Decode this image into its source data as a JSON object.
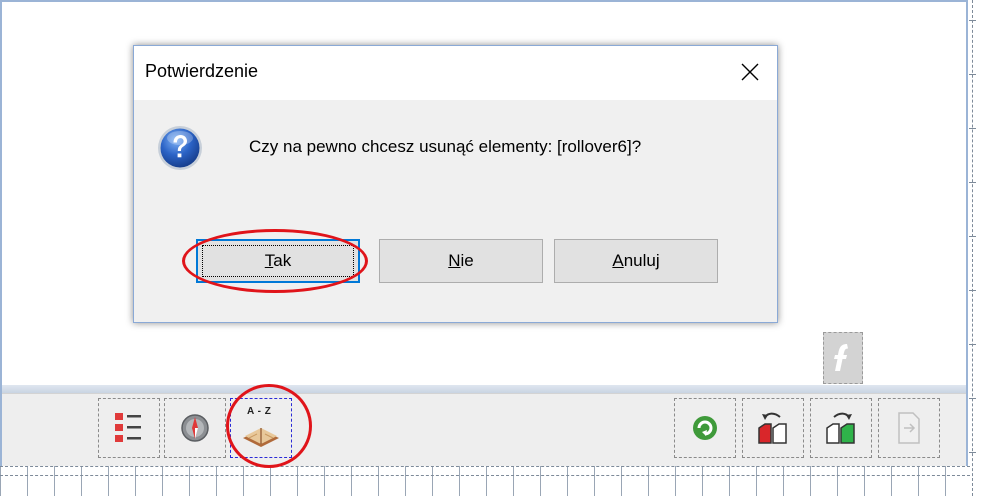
{
  "dialog": {
    "title": "Potwierdzenie",
    "message": "Czy na pewno chcesz usunąć elementy: [rollover6]?",
    "icon": "question-icon",
    "buttons": [
      {
        "label_accel": "T",
        "label_rest": "ak",
        "default": true
      },
      {
        "label_accel": "N",
        "label_rest": "ie",
        "default": false
      },
      {
        "label_accel": "A",
        "label_rest": "nuluj",
        "default": false
      }
    ]
  },
  "toolbar": {
    "sort_az_label": "A - Z",
    "left_buttons": [
      "list-view-icon",
      "navigator-icon",
      "sort-az-icon"
    ],
    "right_buttons": [
      "refresh-icon",
      "undo-page-icon",
      "redo-page-icon",
      "export-page-icon"
    ]
  },
  "colors": {
    "annotation_red": "#e0141a",
    "accent_blue": "#0078d7",
    "dialog_bg": "#f0f0f0",
    "toolbar_bg": "#eeeeee"
  }
}
